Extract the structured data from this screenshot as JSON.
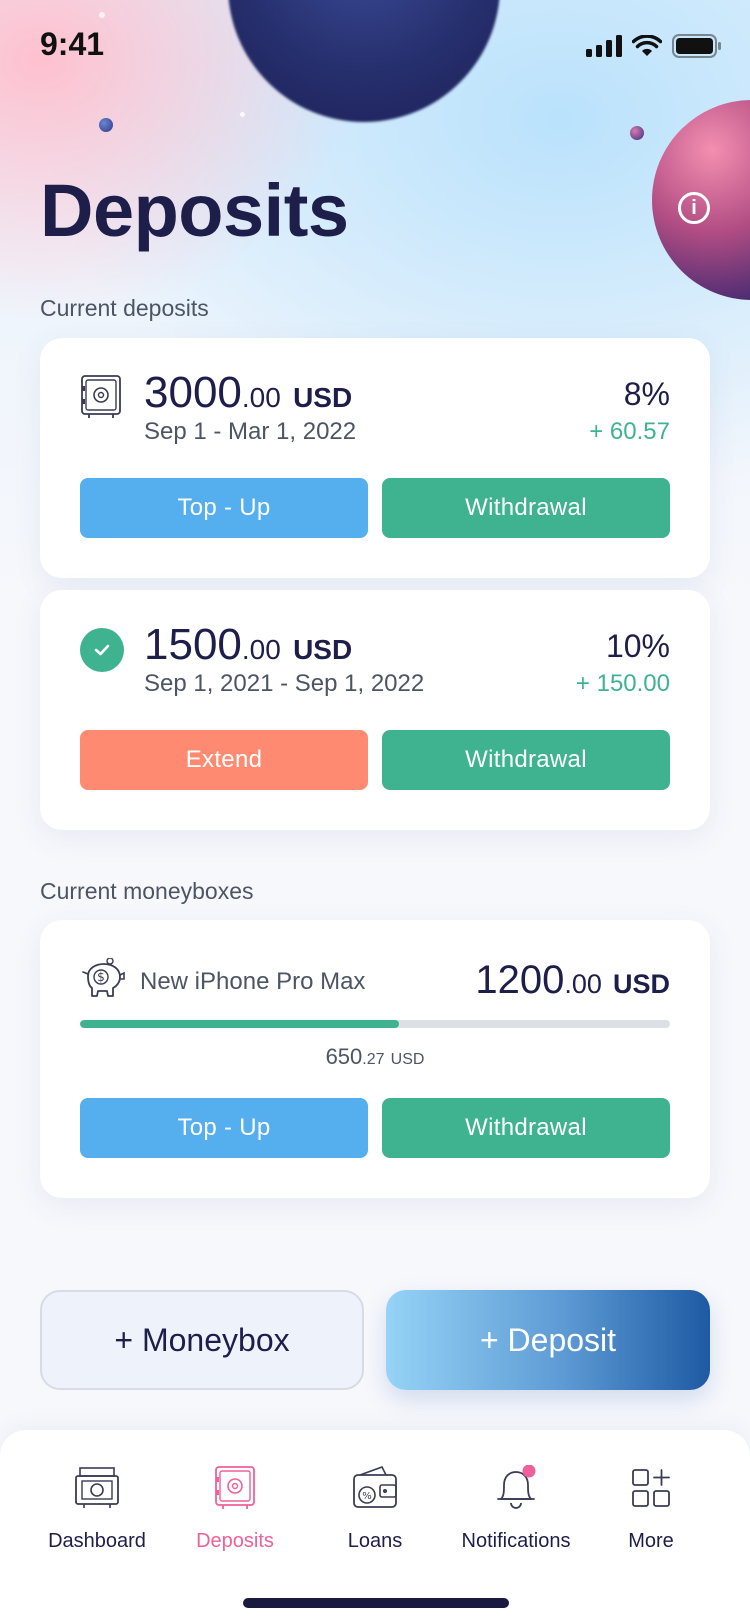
{
  "status_bar": {
    "time": "9:41"
  },
  "page": {
    "title": "Deposits"
  },
  "sections": {
    "deposits_label": "Current deposits",
    "moneyboxes_label": "Current moneyboxes"
  },
  "deposits": [
    {
      "amount_int": "3000",
      "amount_dec": ".00",
      "currency": "USD",
      "period": "Sep 1 - Mar 1, 2022",
      "rate": "8%",
      "gain": "+ 60.57",
      "primary_action": "Top - Up",
      "secondary_action": "Withdrawal"
    },
    {
      "amount_int": "1500",
      "amount_dec": ".00",
      "currency": "USD",
      "period": "Sep 1, 2021 - Sep 1, 2022",
      "rate": "10%",
      "gain": "+ 150.00",
      "primary_action": "Extend",
      "secondary_action": "Withdrawal"
    }
  ],
  "moneybox": {
    "name": "New iPhone Pro Max",
    "goal_int": "1200",
    "goal_dec": ".00",
    "currency": "USD",
    "saved_int": "650",
    "saved_dec": ".27",
    "saved_currency": "USD",
    "progress": 0.54,
    "primary_action": "Top - Up",
    "secondary_action": "Withdrawal"
  },
  "actions": {
    "add_moneybox": "+ Moneybox",
    "add_deposit": "+ Deposit"
  },
  "tabbar": {
    "items": [
      {
        "label": "Dashboard",
        "icon": "cash-icon"
      },
      {
        "label": "Deposits",
        "icon": "safe-icon",
        "active": true
      },
      {
        "label": "Loans",
        "icon": "wallet-icon"
      },
      {
        "label": "Notifications",
        "icon": "bell-icon",
        "badge": true
      },
      {
        "label": "More",
        "icon": "grid-plus-icon"
      }
    ]
  },
  "colors": {
    "primary_text": "#1e1e4b",
    "accent_green": "#3fb38f",
    "accent_blue": "#55aeed",
    "accent_orange": "#ff8a72",
    "accent_pink": "#f0609a"
  }
}
